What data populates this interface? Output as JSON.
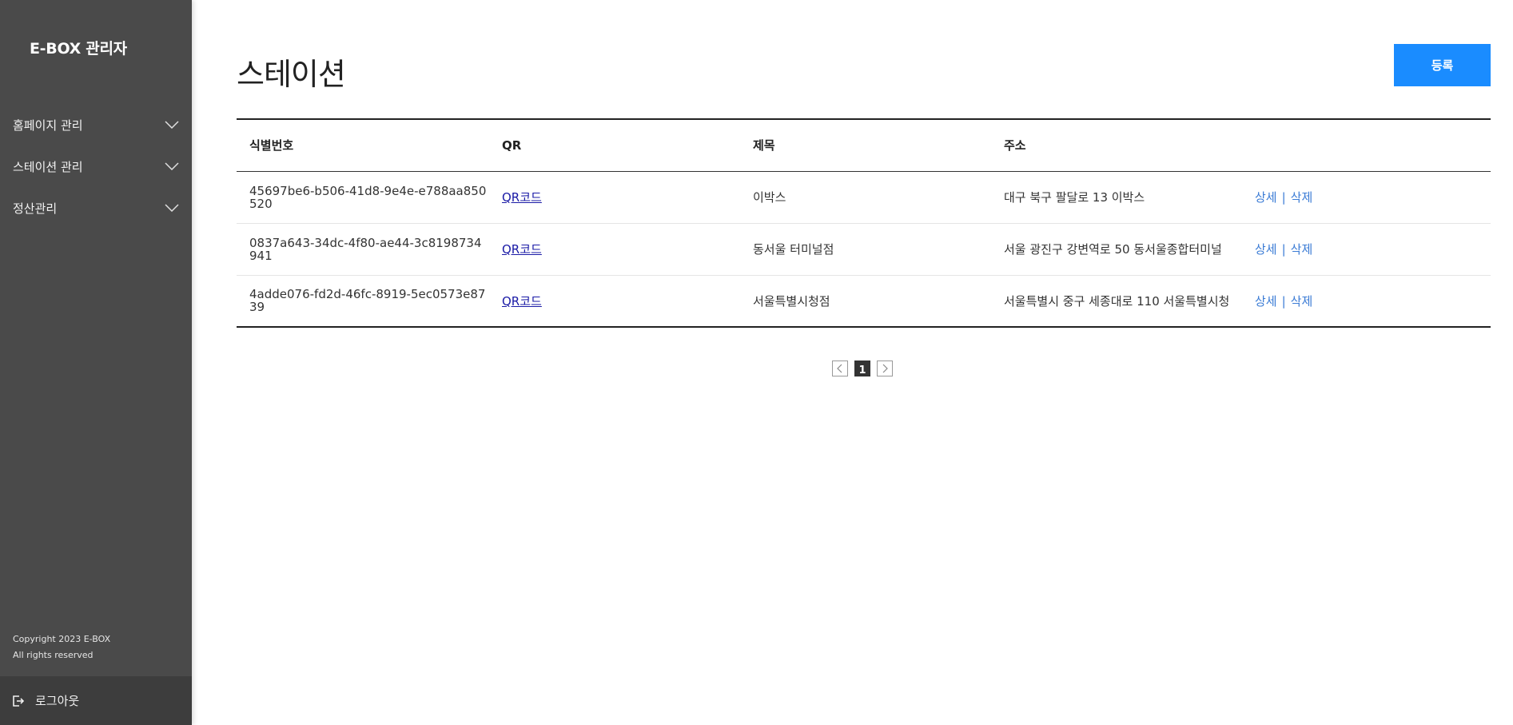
{
  "sidebar": {
    "brand": "E-BOX 관리자",
    "menu": [
      {
        "label": "홈페이지 관리"
      },
      {
        "label": "스테이션 관리"
      },
      {
        "label": "정산관리"
      }
    ],
    "copyright_line1": "Copyright 2023 E-BOX",
    "copyright_line2": "All rights reserved",
    "logout_label": "로그아웃"
  },
  "main": {
    "title": "스테이션",
    "register_label": "등록",
    "table": {
      "headers": [
        "식별번호",
        "QR",
        "제목",
        "주소",
        ""
      ],
      "rows": [
        {
          "id": "45697be6-b506-41d8-9e4e-e788aa850520",
          "qr": "QR코드",
          "title": "이박스",
          "address": "대구 북구 팔달로 13 이박스",
          "detail": "상세",
          "sep": "|",
          "delete": "삭제"
        },
        {
          "id": "0837a643-34dc-4f80-ae44-3c8198734941",
          "qr": "QR코드",
          "title": "동서울 터미널점",
          "address": "서울 광진구 강변역로 50 동서울종합터미널",
          "detail": "상세",
          "sep": "|",
          "delete": "삭제"
        },
        {
          "id": "4adde076-fd2d-46fc-8919-5ec0573e8739",
          "qr": "QR코드",
          "title": "서울특별시청점",
          "address": "서울특별시 중구 세종대로 110 서울특별시청",
          "detail": "상세",
          "sep": "|",
          "delete": "삭제"
        }
      ]
    },
    "pagination": {
      "current": "1",
      "prev_icon": "chevron-left-icon",
      "next_icon": "chevron-right-icon"
    }
  },
  "colors": {
    "sidebar_bg": "#4a4a4a",
    "accent": "#1a8cff",
    "link": "#3a7bd5"
  }
}
